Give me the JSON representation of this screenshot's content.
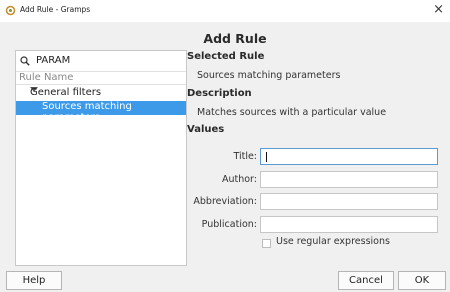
{
  "window": {
    "title": "Add Rule - Gramps",
    "close_glyph": "×"
  },
  "heading": "Add Rule",
  "left_panel": {
    "search_value": "PARAM",
    "column_header": "Rule Name",
    "tree": {
      "parent_label": "General filters",
      "selected_child": "Sources matching parameters"
    }
  },
  "selected_rule": {
    "heading": "Selected Rule",
    "value": "Sources matching parameters"
  },
  "description": {
    "heading": "Description",
    "value": "Matches sources with a particular value"
  },
  "values": {
    "heading": "Values",
    "fields": [
      {
        "label": "Title:",
        "value": ""
      },
      {
        "label": "Author:",
        "value": ""
      },
      {
        "label": "Abbreviation:",
        "value": ""
      },
      {
        "label": "Publication:",
        "value": ""
      }
    ],
    "regex_label": "Use regular expressions",
    "regex_checked": false
  },
  "buttons": {
    "help": "Help",
    "cancel": "Cancel",
    "ok": "OK"
  },
  "colors": {
    "selection": "#3d9ae8",
    "focus_border": "#5b9bd5"
  },
  "icons": [
    "gramps-app-icon",
    "search-icon",
    "expand-triangle-icon",
    "close-icon"
  ]
}
